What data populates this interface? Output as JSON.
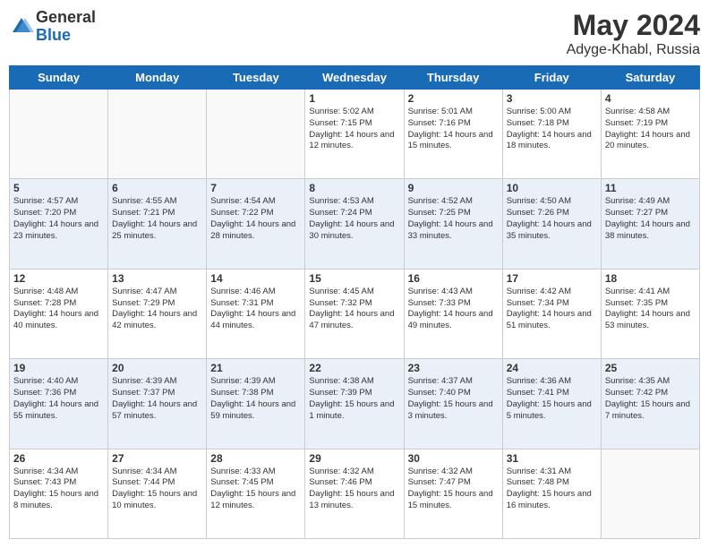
{
  "logo": {
    "general": "General",
    "blue": "Blue"
  },
  "header": {
    "month": "May 2024",
    "location": "Adyge-Khabl, Russia"
  },
  "days_of_week": [
    "Sunday",
    "Monday",
    "Tuesday",
    "Wednesday",
    "Thursday",
    "Friday",
    "Saturday"
  ],
  "weeks": [
    {
      "alt": false,
      "days": [
        {
          "number": "",
          "info": ""
        },
        {
          "number": "",
          "info": ""
        },
        {
          "number": "",
          "info": ""
        },
        {
          "number": "1",
          "info": "Sunrise: 5:02 AM\nSunset: 7:15 PM\nDaylight: 14 hours and 12 minutes."
        },
        {
          "number": "2",
          "info": "Sunrise: 5:01 AM\nSunset: 7:16 PM\nDaylight: 14 hours and 15 minutes."
        },
        {
          "number": "3",
          "info": "Sunrise: 5:00 AM\nSunset: 7:18 PM\nDaylight: 14 hours and 18 minutes."
        },
        {
          "number": "4",
          "info": "Sunrise: 4:58 AM\nSunset: 7:19 PM\nDaylight: 14 hours and 20 minutes."
        }
      ]
    },
    {
      "alt": true,
      "days": [
        {
          "number": "5",
          "info": "Sunrise: 4:57 AM\nSunset: 7:20 PM\nDaylight: 14 hours and 23 minutes."
        },
        {
          "number": "6",
          "info": "Sunrise: 4:55 AM\nSunset: 7:21 PM\nDaylight: 14 hours and 25 minutes."
        },
        {
          "number": "7",
          "info": "Sunrise: 4:54 AM\nSunset: 7:22 PM\nDaylight: 14 hours and 28 minutes."
        },
        {
          "number": "8",
          "info": "Sunrise: 4:53 AM\nSunset: 7:24 PM\nDaylight: 14 hours and 30 minutes."
        },
        {
          "number": "9",
          "info": "Sunrise: 4:52 AM\nSunset: 7:25 PM\nDaylight: 14 hours and 33 minutes."
        },
        {
          "number": "10",
          "info": "Sunrise: 4:50 AM\nSunset: 7:26 PM\nDaylight: 14 hours and 35 minutes."
        },
        {
          "number": "11",
          "info": "Sunrise: 4:49 AM\nSunset: 7:27 PM\nDaylight: 14 hours and 38 minutes."
        }
      ]
    },
    {
      "alt": false,
      "days": [
        {
          "number": "12",
          "info": "Sunrise: 4:48 AM\nSunset: 7:28 PM\nDaylight: 14 hours and 40 minutes."
        },
        {
          "number": "13",
          "info": "Sunrise: 4:47 AM\nSunset: 7:29 PM\nDaylight: 14 hours and 42 minutes."
        },
        {
          "number": "14",
          "info": "Sunrise: 4:46 AM\nSunset: 7:31 PM\nDaylight: 14 hours and 44 minutes."
        },
        {
          "number": "15",
          "info": "Sunrise: 4:45 AM\nSunset: 7:32 PM\nDaylight: 14 hours and 47 minutes."
        },
        {
          "number": "16",
          "info": "Sunrise: 4:43 AM\nSunset: 7:33 PM\nDaylight: 14 hours and 49 minutes."
        },
        {
          "number": "17",
          "info": "Sunrise: 4:42 AM\nSunset: 7:34 PM\nDaylight: 14 hours and 51 minutes."
        },
        {
          "number": "18",
          "info": "Sunrise: 4:41 AM\nSunset: 7:35 PM\nDaylight: 14 hours and 53 minutes."
        }
      ]
    },
    {
      "alt": true,
      "days": [
        {
          "number": "19",
          "info": "Sunrise: 4:40 AM\nSunset: 7:36 PM\nDaylight: 14 hours and 55 minutes."
        },
        {
          "number": "20",
          "info": "Sunrise: 4:39 AM\nSunset: 7:37 PM\nDaylight: 14 hours and 57 minutes."
        },
        {
          "number": "21",
          "info": "Sunrise: 4:39 AM\nSunset: 7:38 PM\nDaylight: 14 hours and 59 minutes."
        },
        {
          "number": "22",
          "info": "Sunrise: 4:38 AM\nSunset: 7:39 PM\nDaylight: 15 hours and 1 minute."
        },
        {
          "number": "23",
          "info": "Sunrise: 4:37 AM\nSunset: 7:40 PM\nDaylight: 15 hours and 3 minutes."
        },
        {
          "number": "24",
          "info": "Sunrise: 4:36 AM\nSunset: 7:41 PM\nDaylight: 15 hours and 5 minutes."
        },
        {
          "number": "25",
          "info": "Sunrise: 4:35 AM\nSunset: 7:42 PM\nDaylight: 15 hours and 7 minutes."
        }
      ]
    },
    {
      "alt": false,
      "days": [
        {
          "number": "26",
          "info": "Sunrise: 4:34 AM\nSunset: 7:43 PM\nDaylight: 15 hours and 8 minutes."
        },
        {
          "number": "27",
          "info": "Sunrise: 4:34 AM\nSunset: 7:44 PM\nDaylight: 15 hours and 10 minutes."
        },
        {
          "number": "28",
          "info": "Sunrise: 4:33 AM\nSunset: 7:45 PM\nDaylight: 15 hours and 12 minutes."
        },
        {
          "number": "29",
          "info": "Sunrise: 4:32 AM\nSunset: 7:46 PM\nDaylight: 15 hours and 13 minutes."
        },
        {
          "number": "30",
          "info": "Sunrise: 4:32 AM\nSunset: 7:47 PM\nDaylight: 15 hours and 15 minutes."
        },
        {
          "number": "31",
          "info": "Sunrise: 4:31 AM\nSunset: 7:48 PM\nDaylight: 15 hours and 16 minutes."
        },
        {
          "number": "",
          "info": ""
        }
      ]
    }
  ]
}
